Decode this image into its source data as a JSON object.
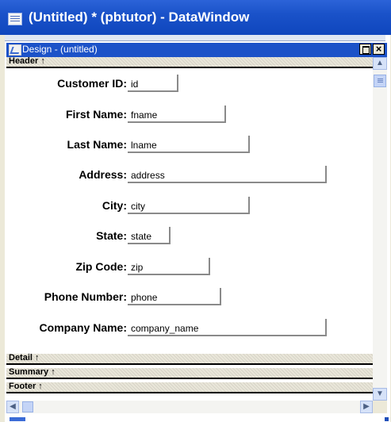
{
  "window": {
    "title": "(Untitled) * (pbtutor) - DataWindow",
    "icon": "window-menu-icon"
  },
  "dw_window": {
    "title": "Design - (untitled)",
    "icon": "design-icon",
    "restore_glyph": "",
    "close_glyph": "×"
  },
  "bands": {
    "header": "Header ↑",
    "detail": "Detail ↑",
    "summary": "Summary ↑",
    "footer": "Footer ↑"
  },
  "fields": [
    {
      "label": "Customer ID:",
      "value": "id"
    },
    {
      "label": "First Name:",
      "value": "fname"
    },
    {
      "label": "Last Name:",
      "value": "lname"
    },
    {
      "label": "Address:",
      "value": "address"
    },
    {
      "label": "City:",
      "value": "city"
    },
    {
      "label": "State:",
      "value": "state"
    },
    {
      "label": "Zip Code:",
      "value": "zip"
    },
    {
      "label": "Phone Number:",
      "value": "phone"
    },
    {
      "label": "Company Name:",
      "value": "company_name"
    }
  ],
  "scroll": {
    "up": "▲",
    "down": "▼",
    "left": "◀",
    "right": "▶"
  },
  "colors": {
    "title_bar": "#1a52c9",
    "dw_title_bar": "#1c52c8",
    "band_bar": "#e9e6d9"
  }
}
